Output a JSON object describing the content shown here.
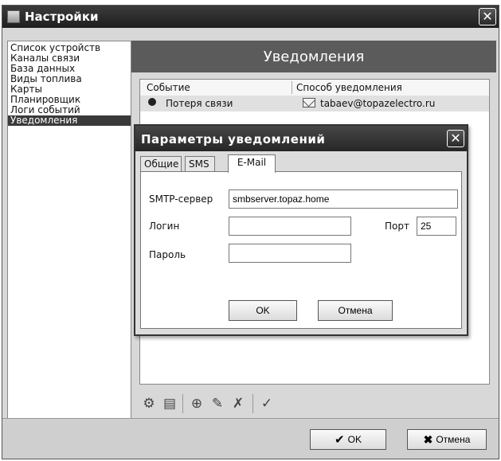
{
  "window": {
    "title": "Настройки",
    "close": "✕"
  },
  "sidebar": {
    "items": [
      "Список устройств",
      "Каналы связи",
      "База данных",
      "Виды топлива",
      "Карты",
      "Планировщик",
      "Логи событий",
      "Уведомления"
    ],
    "selected_index": 7
  },
  "header": {
    "title": "Уведомления"
  },
  "table": {
    "columns": [
      "Событие",
      "Способ уведомления"
    ],
    "rows": [
      {
        "event": "Потеря связи",
        "method": "tabaev@topazelectro.ru"
      }
    ]
  },
  "toolbar": {
    "icons": [
      "settings-gear-icon",
      "document-settings-icon",
      "add-icon",
      "edit-icon",
      "delete-icon",
      "check-icon"
    ]
  },
  "footer": {
    "ok_label": "OK",
    "cancel_label": "Отмена"
  },
  "dialog": {
    "title": "Параметры уведомлений",
    "close": "✕",
    "tabs": [
      "Общие",
      "SMS",
      "E-Mail"
    ],
    "active_tab": 2,
    "smtp_label": "SMTP-сервер",
    "smtp_value": "smbserver.topaz.home",
    "login_label": "Логин",
    "login_value": "",
    "port_label": "Порт",
    "port_value": "25",
    "password_label": "Пароль",
    "password_value": "",
    "ok_label": "OK",
    "cancel_label": "Отмена"
  }
}
